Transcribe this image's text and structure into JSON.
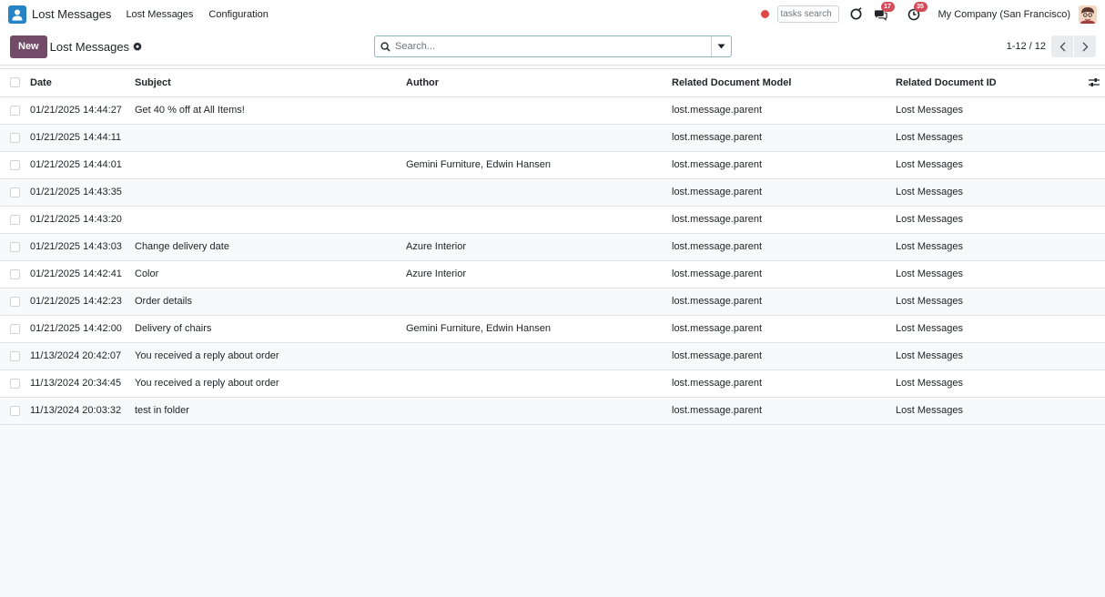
{
  "navbar": {
    "brand": "Lost Messages",
    "menu": [
      "Lost Messages",
      "Configuration"
    ],
    "tasks_search_placeholder": "tasks search",
    "chat_badge": "17",
    "activity_badge": "35",
    "company": "My Company (San Francisco)",
    "colors": {
      "app_icon": "#2684c6",
      "record_dot": "#e04848",
      "badge": "#d44c59"
    }
  },
  "control": {
    "new_label": "New",
    "breadcrumb": "Lost Messages",
    "search_placeholder": "Search...",
    "pager": "1-12 / 12",
    "colors": {
      "new_button": "#714b67"
    }
  },
  "table": {
    "columns": [
      "Date",
      "Subject",
      "Author",
      "Related Document Model",
      "Related Document ID"
    ],
    "rows": [
      {
        "date": "01/21/2025 14:44:27",
        "subject": "Get 40 % off at All Items!",
        "author": "",
        "model": "lost.message.parent",
        "doc_id": "Lost Messages"
      },
      {
        "date": "01/21/2025 14:44:11",
        "subject": "",
        "author": "",
        "model": "lost.message.parent",
        "doc_id": "Lost Messages"
      },
      {
        "date": "01/21/2025 14:44:01",
        "subject": "",
        "author": "Gemini Furniture, Edwin Hansen",
        "model": "lost.message.parent",
        "doc_id": "Lost Messages"
      },
      {
        "date": "01/21/2025 14:43:35",
        "subject": "",
        "author": "",
        "model": "lost.message.parent",
        "doc_id": "Lost Messages"
      },
      {
        "date": "01/21/2025 14:43:20",
        "subject": "",
        "author": "",
        "model": "lost.message.parent",
        "doc_id": "Lost Messages"
      },
      {
        "date": "01/21/2025 14:43:03",
        "subject": "Change delivery date",
        "author": "Azure Interior",
        "model": "lost.message.parent",
        "doc_id": "Lost Messages"
      },
      {
        "date": "01/21/2025 14:42:41",
        "subject": "Color",
        "author": "Azure Interior",
        "model": "lost.message.parent",
        "doc_id": "Lost Messages"
      },
      {
        "date": "01/21/2025 14:42:23",
        "subject": "Order details",
        "author": "",
        "model": "lost.message.parent",
        "doc_id": "Lost Messages"
      },
      {
        "date": "01/21/2025 14:42:00",
        "subject": "Delivery of chairs",
        "author": "Gemini Furniture, Edwin Hansen",
        "model": "lost.message.parent",
        "doc_id": "Lost Messages"
      },
      {
        "date": "11/13/2024 20:42:07",
        "subject": "You received a reply about order",
        "author": "",
        "model": "lost.message.parent",
        "doc_id": "Lost Messages"
      },
      {
        "date": "11/13/2024 20:34:45",
        "subject": "You received a reply about order",
        "author": "",
        "model": "lost.message.parent",
        "doc_id": "Lost Messages"
      },
      {
        "date": "11/13/2024 20:03:32",
        "subject": "test in folder",
        "author": "",
        "model": "lost.message.parent",
        "doc_id": "Lost Messages"
      }
    ]
  }
}
